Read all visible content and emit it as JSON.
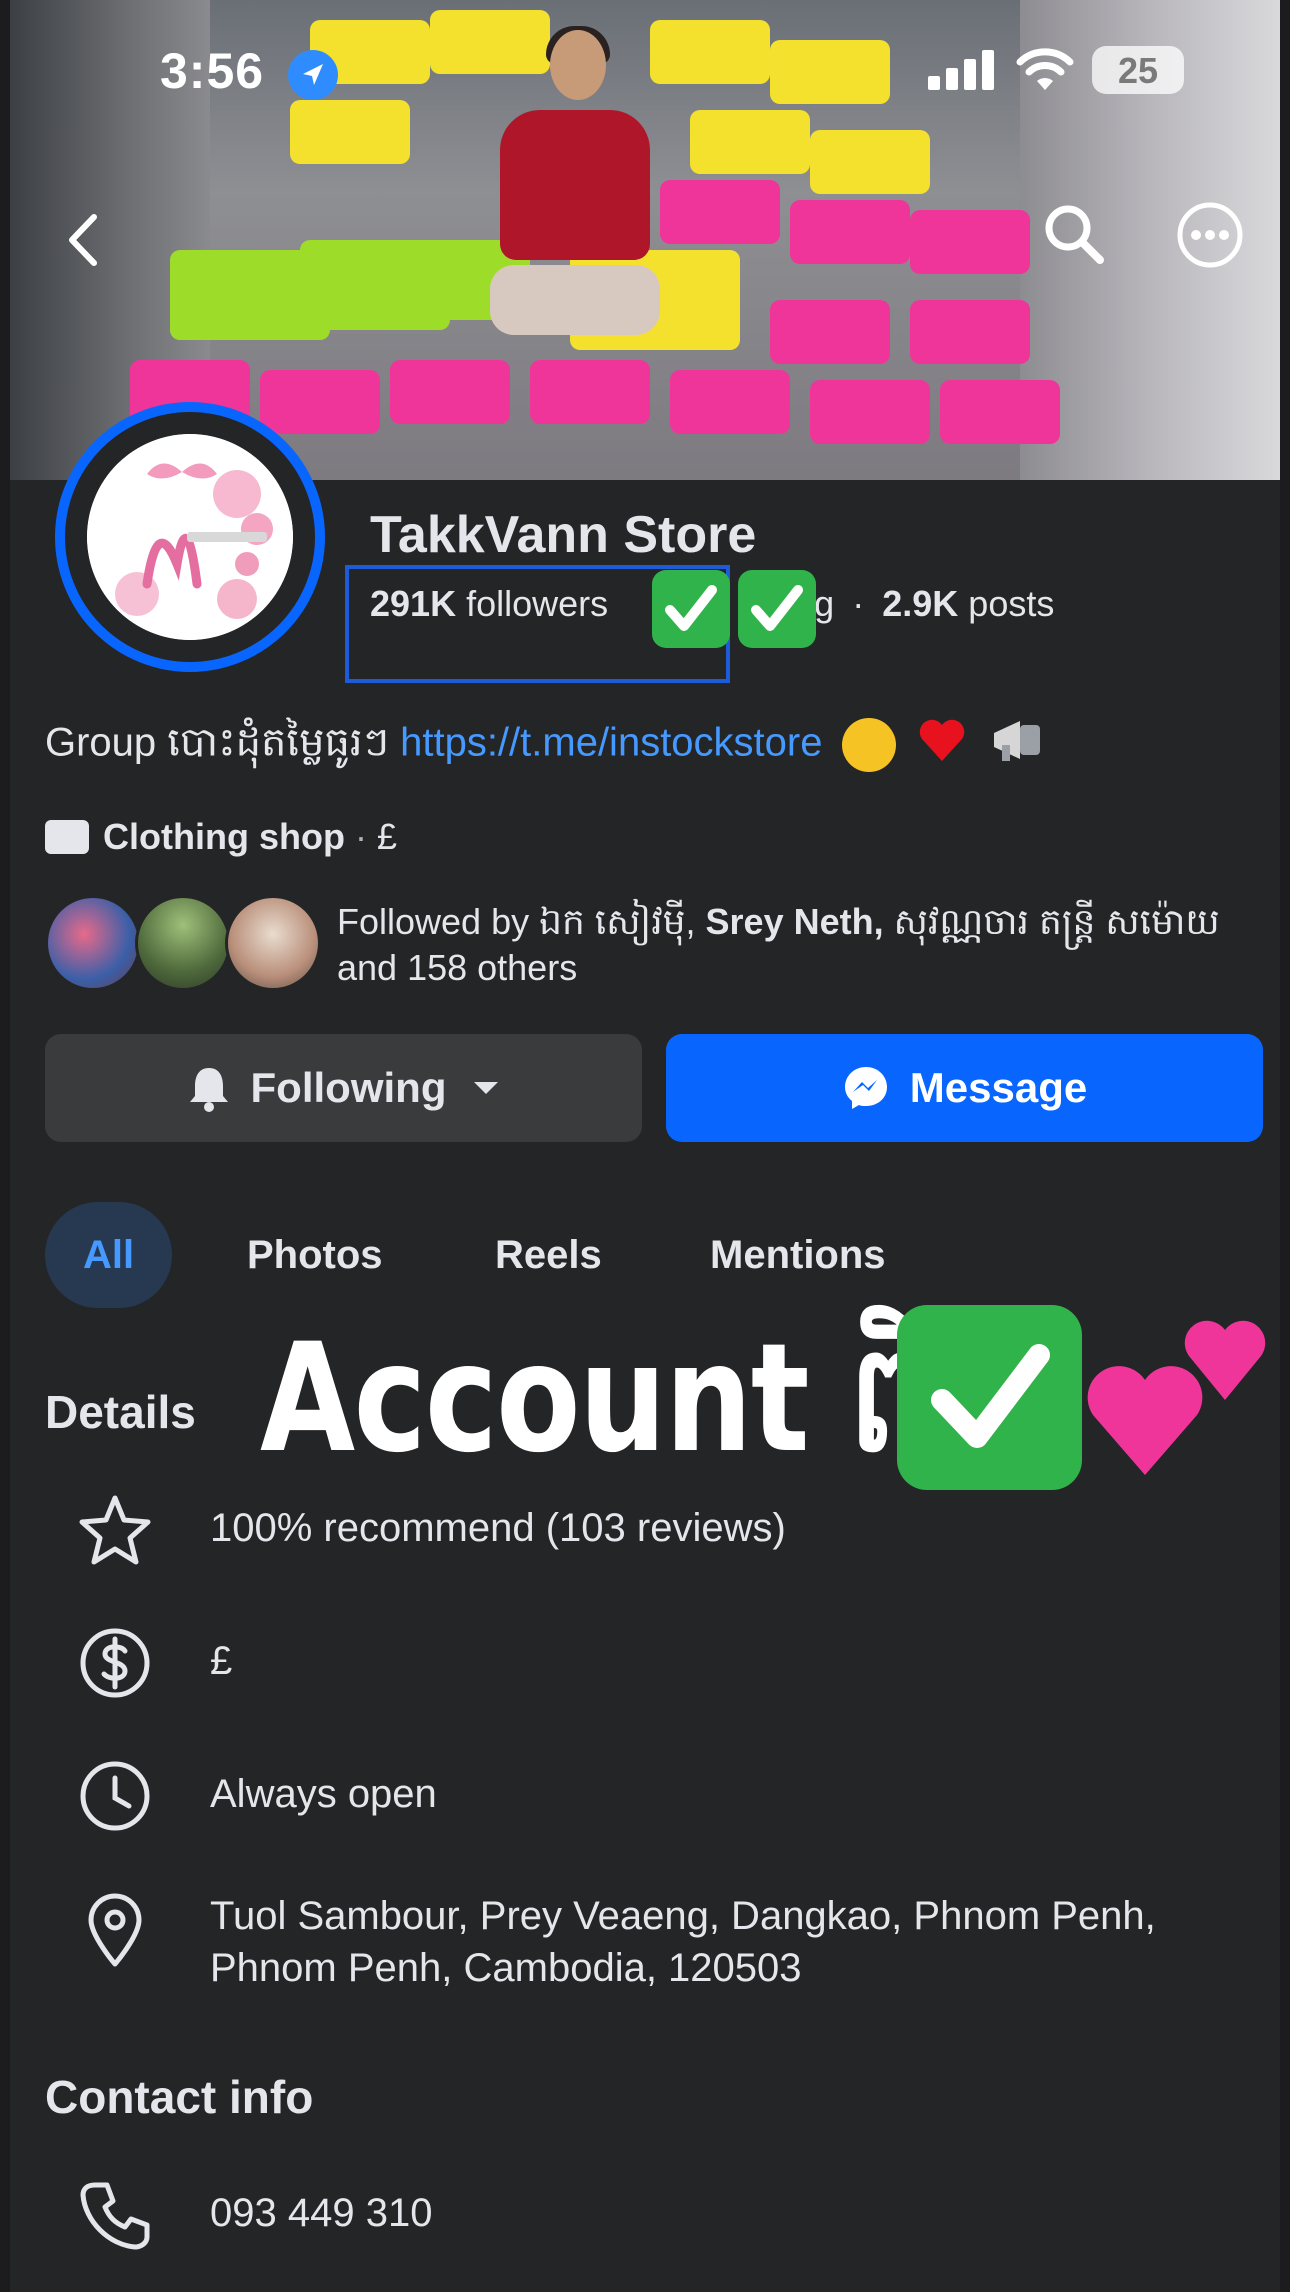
{
  "status_bar": {
    "time": "3:56",
    "battery": "25"
  },
  "page": {
    "name": "TakkVann Store",
    "followers_count": "291K",
    "followers_label": "followers",
    "following_fragment": "ing",
    "separator": "·",
    "posts_count": "2.9K",
    "posts_label": "posts"
  },
  "bio": {
    "prefix": "Group បោះដុំតម្លៃធូរៗ",
    "link": "https://t.me/instockstore"
  },
  "category": {
    "label": "Clothing shop",
    "separator": "·",
    "price": "£"
  },
  "followed_by": {
    "prefix": "Followed by ឯក សៀវម៉ី,",
    "name1": "Srey Neth,",
    "rest": "សុវណ្ណចារ តន្រ្តី សម៉ោយ and 158 others"
  },
  "buttons": {
    "following": "Following",
    "message": "Message"
  },
  "tabs": [
    {
      "label": "All",
      "active": true
    },
    {
      "label": "Photos"
    },
    {
      "label": "Reels"
    },
    {
      "label": "Mentions"
    }
  ],
  "details": {
    "title": "Details",
    "overlay": "Account ពិត",
    "rows": [
      {
        "icon": "star-icon",
        "text": "100% recommend (103 reviews)"
      },
      {
        "icon": "dollar-icon",
        "text": "£"
      },
      {
        "icon": "clock-icon",
        "text": "Always open"
      },
      {
        "icon": "location-pin-icon",
        "text": "Tuol Sambour, Prey Veaeng, Dangkao, Phnom Penh, Phnom Penh, Cambodia, 120503"
      }
    ]
  },
  "contact": {
    "title": "Contact info",
    "phone": "093 449 310",
    "icon": "phone-icon"
  },
  "colors": {
    "accent": "#0866ff",
    "link": "#4599ff",
    "background": "#242526",
    "check": "#2fb34a"
  }
}
